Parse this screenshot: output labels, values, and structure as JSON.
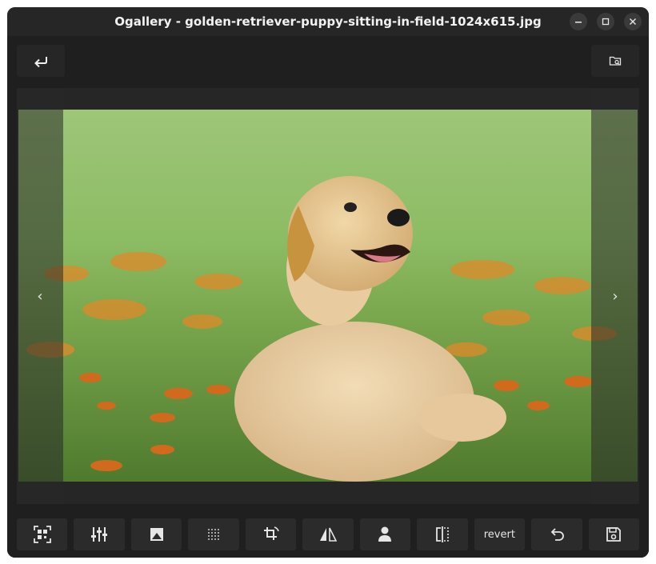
{
  "window": {
    "title": "Ogallery - golden-retriever-puppy-sitting-in-field-1024x615.jpg",
    "controls": [
      "minimize-icon",
      "maximize-icon",
      "close-icon"
    ]
  },
  "header": {
    "back_icon": "return-arrow-icon",
    "open_folder_icon": "folder-search-icon"
  },
  "viewer": {
    "prev_label": "‹",
    "next_label": "›"
  },
  "toolbar": {
    "tools": [
      {
        "name": "qr-code-icon"
      },
      {
        "name": "adjust-sliders-icon"
      },
      {
        "name": "filter-image-icon"
      },
      {
        "name": "noise-dots-icon"
      },
      {
        "name": "crop-rotate-icon"
      },
      {
        "name": "flip-icon"
      },
      {
        "name": "person-icon"
      },
      {
        "name": "compare-split-icon"
      },
      {
        "label": "revert"
      },
      {
        "name": "undo-icon"
      },
      {
        "name": "save-icon"
      }
    ],
    "revert_label": "revert"
  }
}
